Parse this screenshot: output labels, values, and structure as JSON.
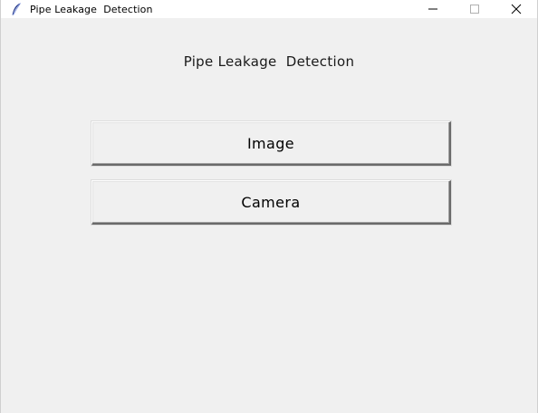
{
  "window": {
    "title": "Pipe Leakage  Detection",
    "icon": "feather-icon",
    "controls": [
      "minimize-icon",
      "maximize-icon",
      "close-icon"
    ]
  },
  "main": {
    "heading": "Pipe Leakage  Detection",
    "buttons": {
      "image_label": "Image",
      "camera_label": "Camera"
    }
  },
  "colors": {
    "background": "#f0f0f0",
    "titlebar": "#ffffff"
  }
}
